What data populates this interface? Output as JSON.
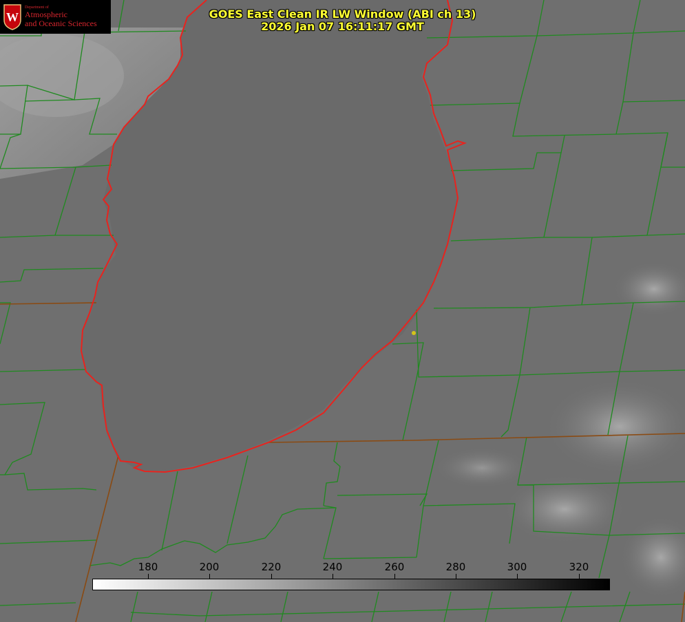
{
  "title": {
    "line1": "GOES East Clean IR LW Window (ABI ch 13)",
    "line2": "2026 Jan 07 16:11:17 GMT"
  },
  "logo": {
    "department": "Department of",
    "line1": "Atmospheric",
    "line2": "and Oceanic Sciences",
    "crest_letter": "W"
  },
  "colorbar": {
    "label_color": "#000000",
    "min_color": "#ffffff",
    "max_color": "#000000",
    "ticks": [
      "180",
      "200",
      "220",
      "240",
      "260",
      "280",
      "300",
      "320"
    ]
  },
  "map": {
    "land_color": "#6f6f6f",
    "lake_color": "#6b6b6b",
    "county_line_color": "#1f8a1f",
    "state_line_color": "#8a4a12",
    "coast_line_color": "#e8231e",
    "marker_color": "#d4c41a"
  }
}
